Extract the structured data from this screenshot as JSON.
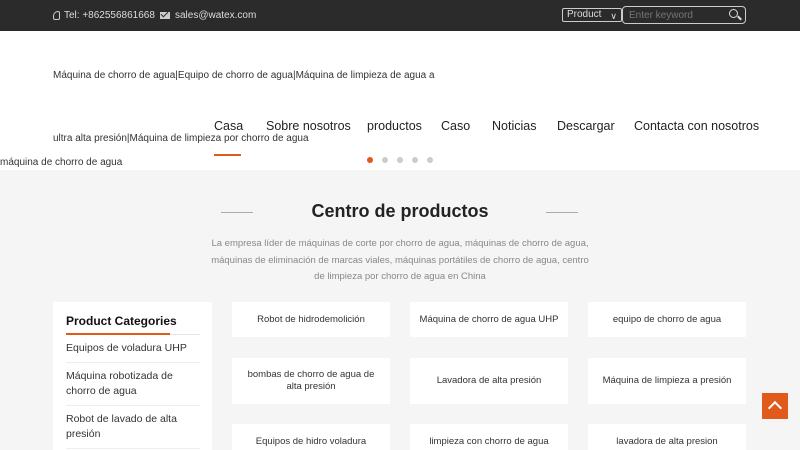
{
  "topbar": {
    "phone": "Tel: +862556861668",
    "email": "sales@watex.com",
    "search_select": "Product",
    "search_placeholder": "Enter keyword"
  },
  "logo_text": {
    "line1": "Máquina de chorro de agua|Equipo de chorro de agua|Máquina de limpieza de agua a",
    "line2": "ultra alta presión|Máquina de limpieza por chorro de agua",
    "line3": "máquina de chorro de agua"
  },
  "nav": [
    {
      "label": "Casa"
    },
    {
      "label": "Sobre nosotros"
    },
    {
      "label": "productos"
    },
    {
      "label": "Caso"
    },
    {
      "label": "Noticias"
    },
    {
      "label": "Descargar"
    },
    {
      "label": "Contacta con nosotros"
    }
  ],
  "slider": {
    "count": 5,
    "active": 0
  },
  "section": {
    "title": "Centro de productos",
    "description": "La empresa líder de máquinas de corte por chorro de agua, máquinas de chorro de agua, máquinas de eliminación de marcas viales, máquinas portátiles de chorro de agua, centro de limpieza por chorro de agua en China"
  },
  "categories": {
    "heading": "Product Categories",
    "items": [
      "Equipos de voladura UHP",
      "Máquina robotizada de chorro de agua",
      "Robot de lavado de alta presión"
    ]
  },
  "products": [
    "Robot de hidrodemolición",
    "Máquina de chorro de agua UHP",
    "equipo de chorro de agua",
    "bombas de chorro de agua de alta presión",
    "Lavadora de alta presión",
    "Máquina de limpieza a presión",
    "Equipos de hidro voladura",
    "limpieza con chorro de agua",
    "lavadora de alta presion"
  ],
  "colors": {
    "accent": "#e05a1c",
    "topbar": "#2b2b2b"
  },
  "icons": {
    "phone": "phone-icon",
    "email": "mail-icon",
    "search": "search-icon",
    "back_to_top": "arrow-up-icon"
  }
}
